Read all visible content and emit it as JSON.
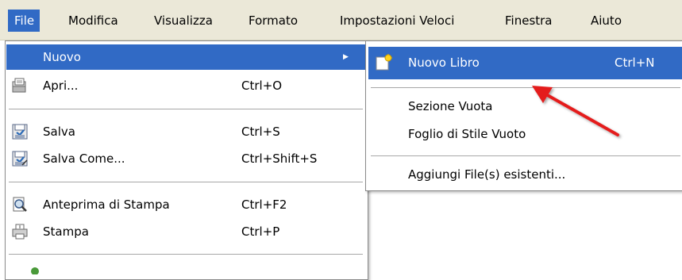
{
  "menubar": {
    "items": [
      {
        "label": "File"
      },
      {
        "label": "Modifica"
      },
      {
        "label": "Visualizza"
      },
      {
        "label": "Formato"
      },
      {
        "label": "Impostazioni Veloci"
      },
      {
        "label": "Finestra"
      },
      {
        "label": "Aiuto"
      }
    ]
  },
  "file_menu": {
    "items": [
      {
        "label": "Nuovo",
        "icon": "none",
        "has_submenu": true
      },
      {
        "label": "Apri...",
        "shortcut": "Ctrl+O",
        "icon": "open-icon"
      },
      {
        "label": "Salva",
        "shortcut": "Ctrl+S",
        "icon": "save-icon"
      },
      {
        "label": "Salva Come...",
        "shortcut": "Ctrl+Shift+S",
        "icon": "save-as-icon"
      },
      {
        "label": "Anteprima di Stampa",
        "shortcut": "Ctrl+F2",
        "icon": "print-preview-icon"
      },
      {
        "label": "Stampa",
        "shortcut": "Ctrl+P",
        "icon": "print-icon"
      }
    ]
  },
  "new_submenu": {
    "items": [
      {
        "label": "Nuovo Libro",
        "shortcut": "Ctrl+N",
        "icon": "new-book-icon"
      },
      {
        "label": "Sezione Vuota"
      },
      {
        "label": "Foglio di Stile Vuoto"
      },
      {
        "label": "Aggiungi File(s) esistenti..."
      }
    ]
  },
  "colors": {
    "highlight": "#316ac5",
    "menubar_bg": "#ebe8d8",
    "arrow_red": "#e41e1e"
  }
}
